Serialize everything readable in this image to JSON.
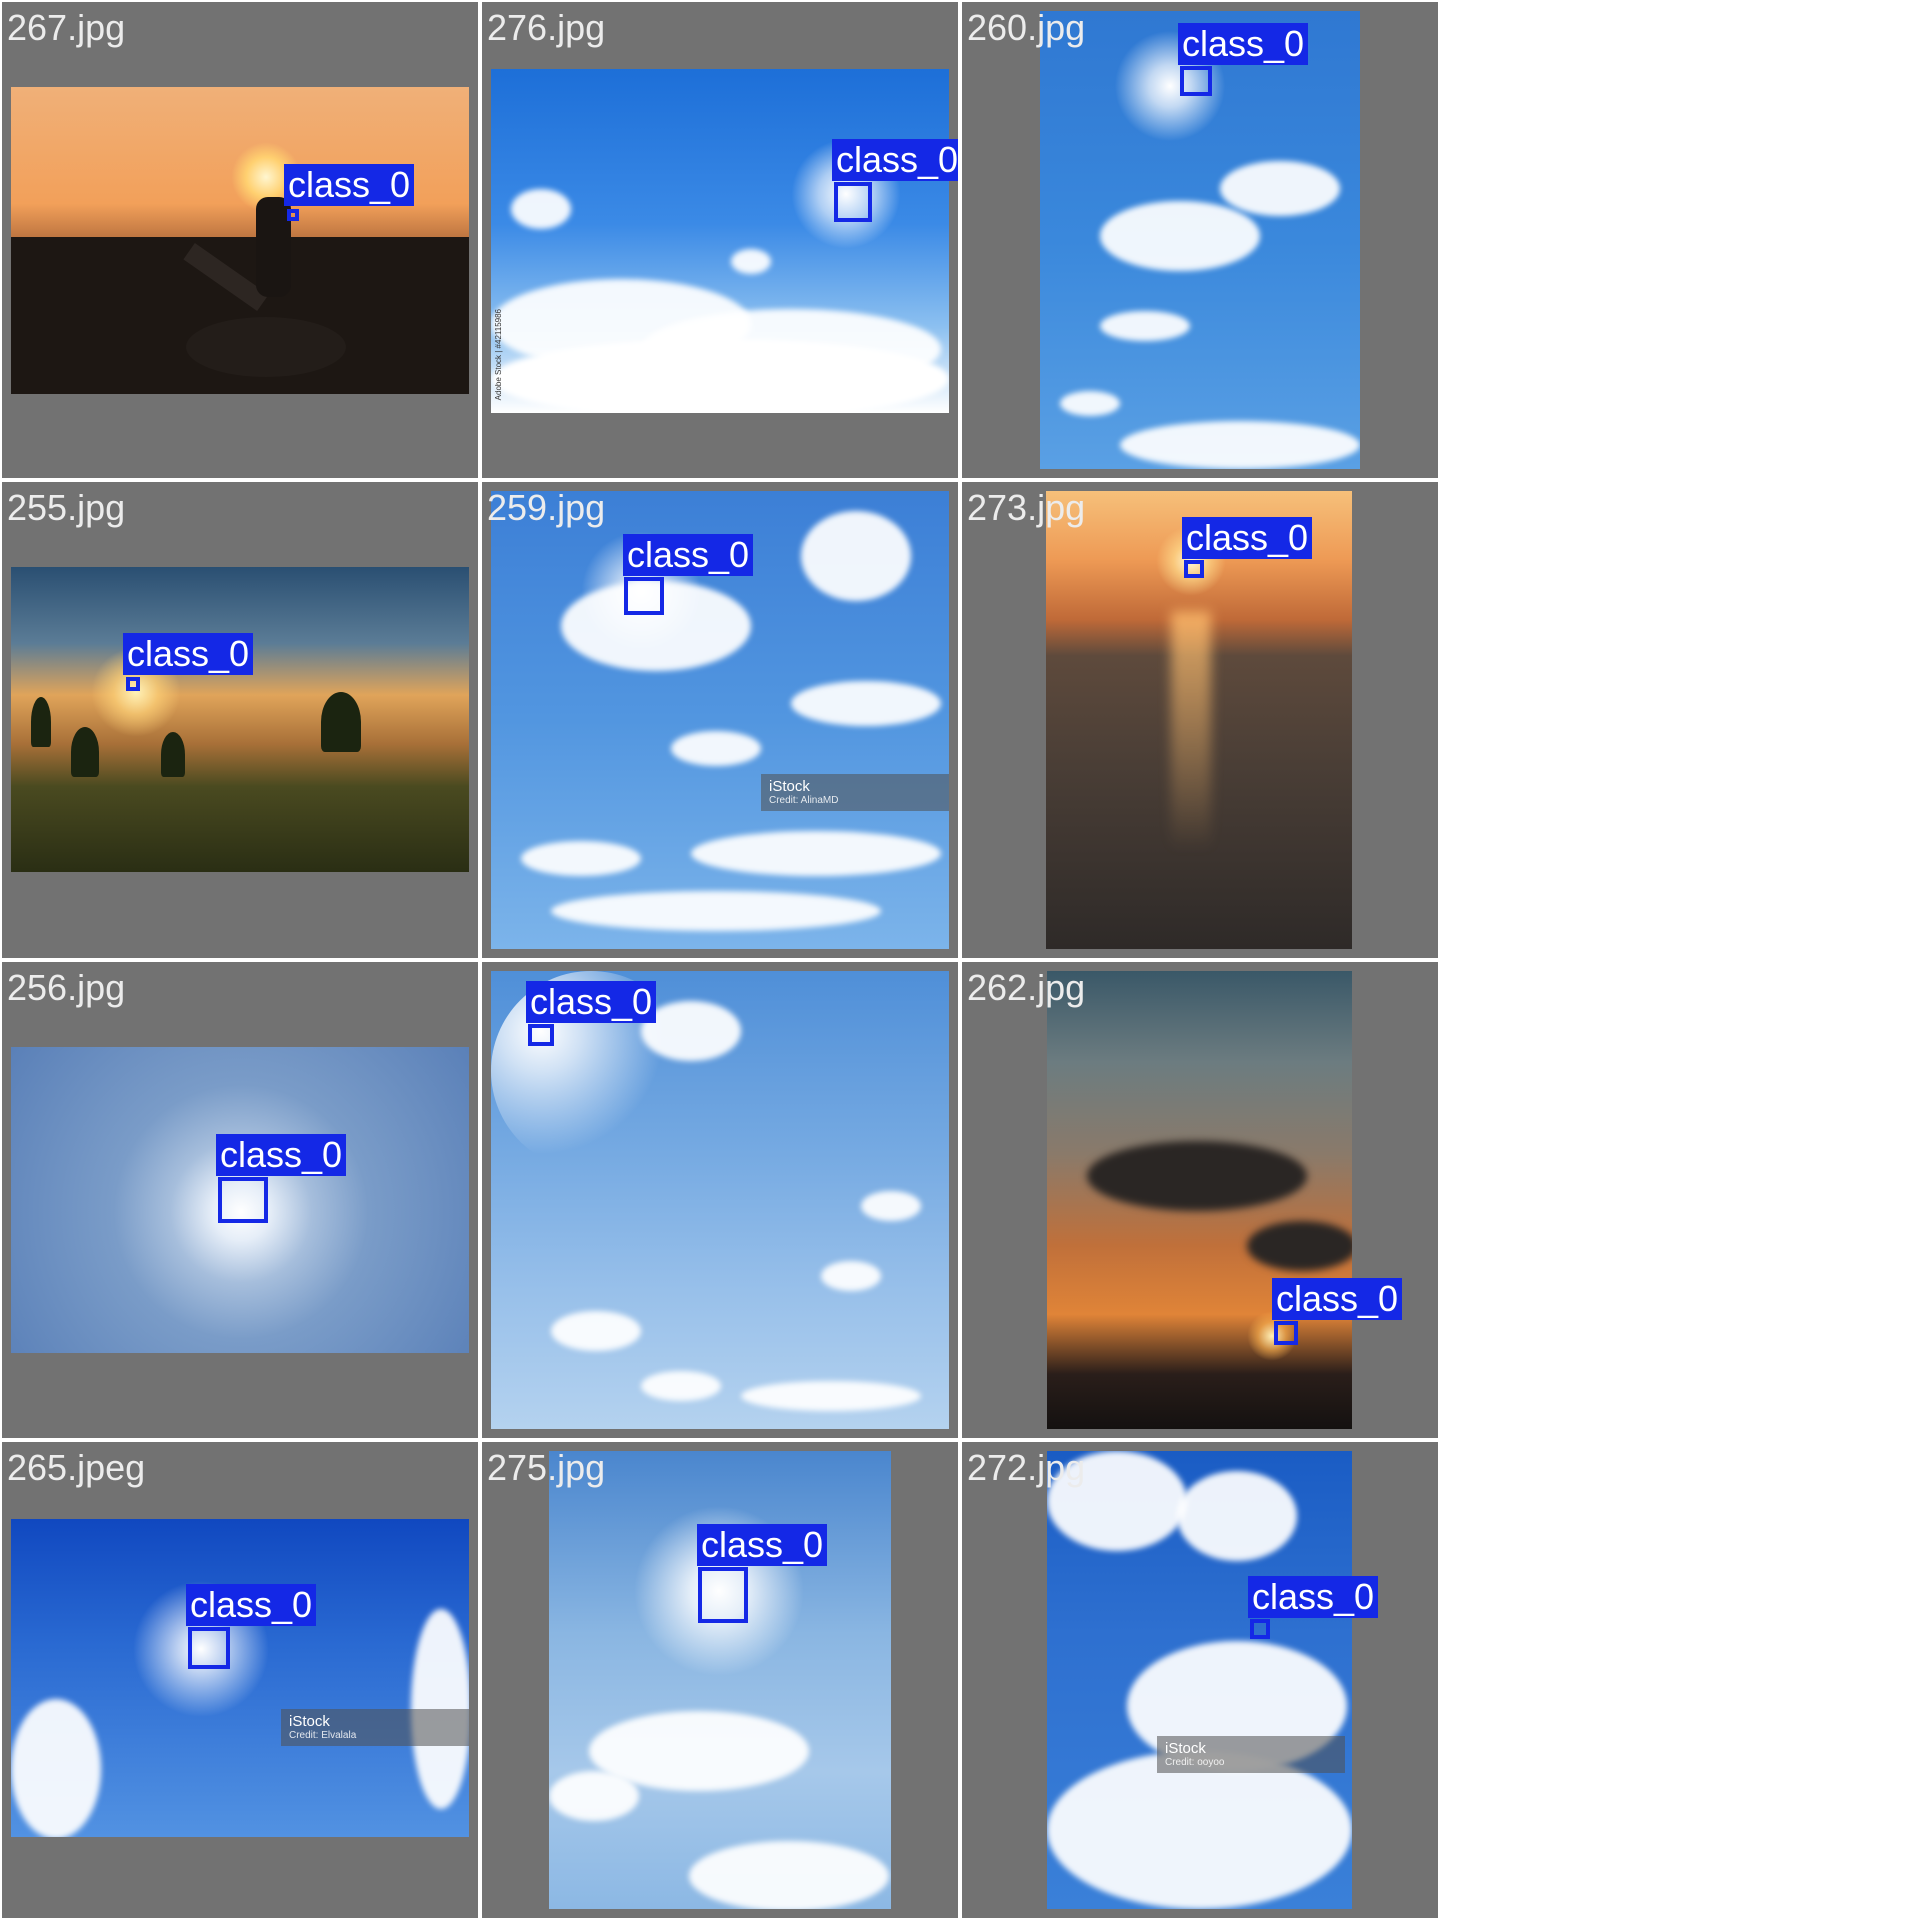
{
  "tiles": [
    {
      "file": "267.jpg",
      "label": "class_0"
    },
    {
      "file": "276.jpg",
      "label": "class_0",
      "side_watermark": "Adobe Stock | #42115986"
    },
    {
      "file": "260.jpg",
      "label": "class_0"
    },
    {
      "file": "255.jpg",
      "label": "class_0"
    },
    {
      "file": "259.jpg",
      "label": "class_0",
      "watermark": {
        "brand": "iStock",
        "credit": "Credit: AlinaMD"
      }
    },
    {
      "file": "273.jpg",
      "label": "class_0"
    },
    {
      "file": "256.jpg",
      "label": "class_0"
    },
    {
      "file": "",
      "label": "class_0"
    },
    {
      "file": "262.jpg",
      "label": "class_0"
    },
    {
      "file": "265.jpeg",
      "label": "class_0",
      "watermark": {
        "brand": "iStock",
        "credit": "Credit: Elvalala"
      }
    },
    {
      "file": "275.jpg",
      "label": "class_0"
    },
    {
      "file": "272.jpg",
      "label": "class_0",
      "watermark": {
        "brand": "iStock",
        "credit": "Credit: ooyoo"
      }
    }
  ],
  "colors": {
    "tile_bg": "#727272",
    "detection": "#1428e6",
    "filename_text": "#ececec"
  }
}
